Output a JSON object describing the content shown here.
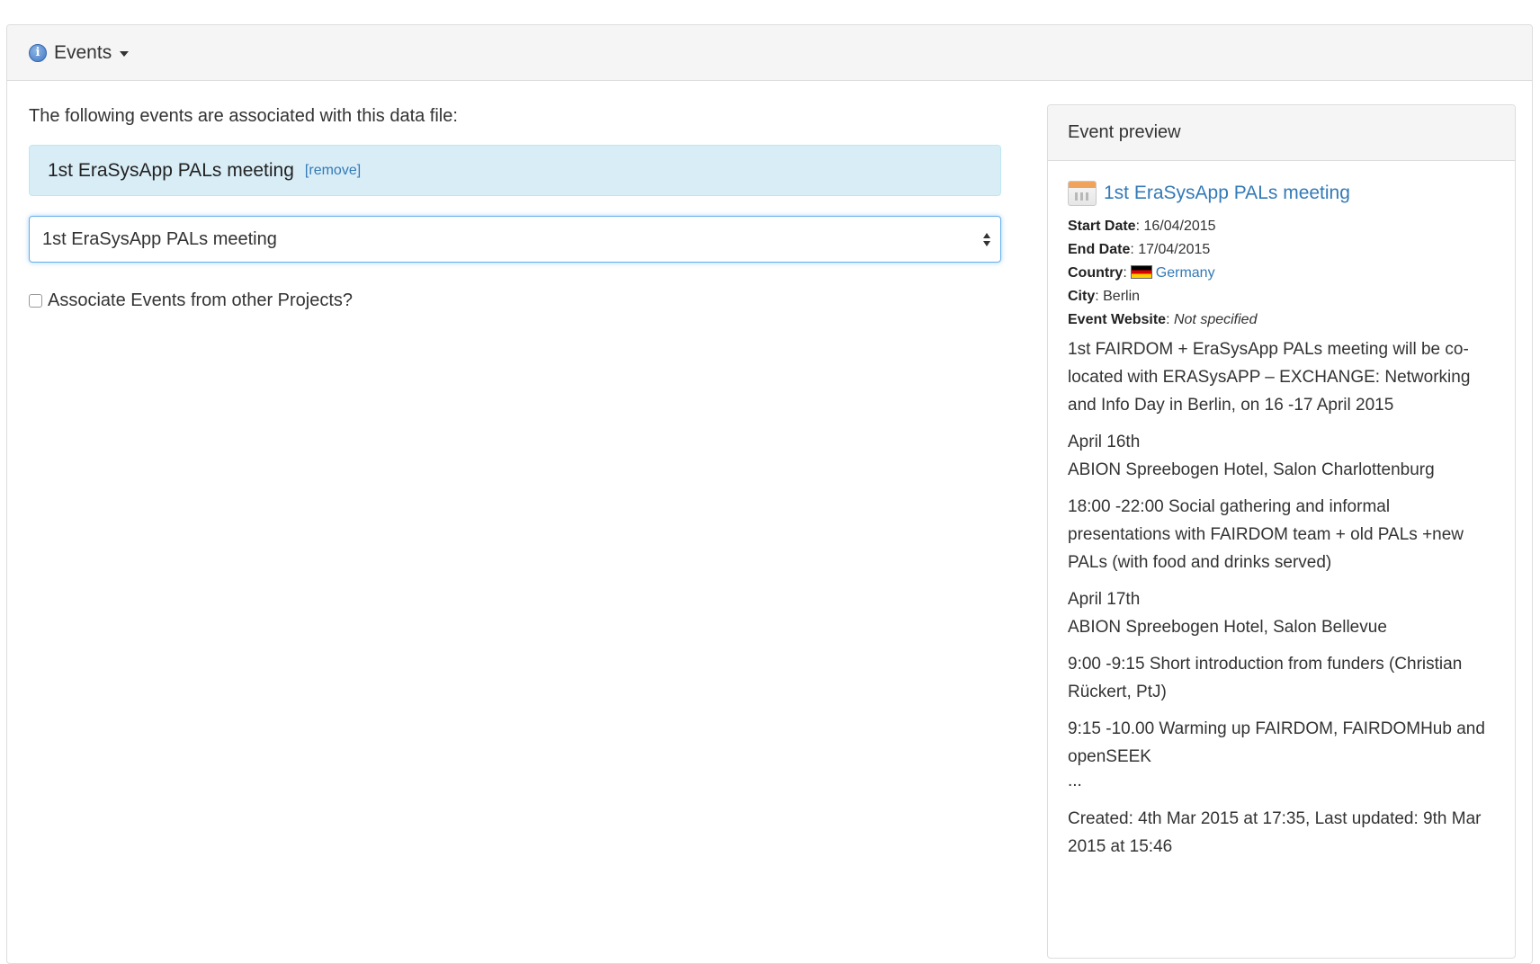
{
  "panel": {
    "title": "Events"
  },
  "main": {
    "intro": "The following events are associated with this data file:",
    "selected_event": {
      "title": "1st EraSysApp PALs meeting",
      "remove_label": "[remove]"
    },
    "select": {
      "value": "1st EraSysApp PALs meeting"
    },
    "checkbox": {
      "label": "Associate Events from other Projects?",
      "checked": false
    }
  },
  "preview": {
    "heading": "Event preview",
    "event_title": "1st EraSysApp PALs meeting",
    "start_date_label": "Start Date",
    "start_date": ": 16/04/2015",
    "end_date_label": "End Date",
    "end_date": ": 17/04/2015",
    "country_label": "Country",
    "country_sep": ":",
    "country": "Germany",
    "city_label": "City",
    "city": ": Berlin",
    "website_label": "Event Website",
    "website_sep": ": ",
    "website": "Not specified",
    "description": [
      "1st FAIRDOM + EraSysApp PALs meeting will be co-located with ERASysAPP – EXCHANGE: Networking and Info Day in Berlin, on 16 -17 April 2015",
      "April 16th\nABION Spreebogen Hotel, Salon Charlottenburg",
      "18:00 -22:00 Social gathering and informal presentations with FAIRDOM team + old PALs +new PALs (with food and drinks served)",
      "April 17th\nABION Spreebogen Hotel, Salon Bellevue",
      "9:00 -9:15 Short introduction from funders (Christian Rückert, PtJ)",
      "9:15 -10.00 Warming up FAIRDOM, FAIRDOMHub and openSEEK"
    ],
    "ellipsis": "...",
    "created": "Created: 4th Mar 2015 at 17:35, Last updated: 9th Mar 2015 at 15:46"
  }
}
